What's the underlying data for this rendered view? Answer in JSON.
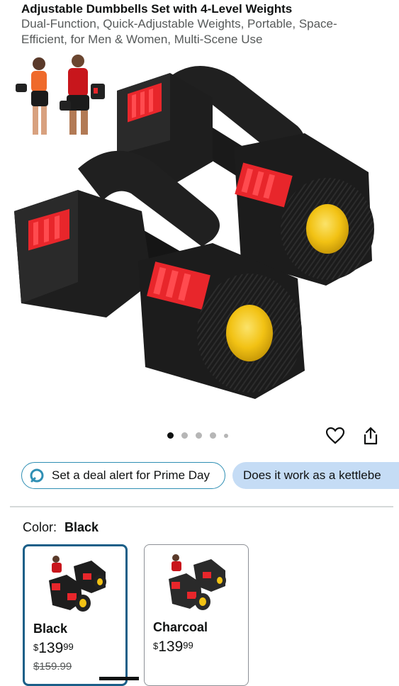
{
  "product": {
    "title": "Adjustable Dumbbells Set with 4-Level Weights",
    "subtitle_line1": "Dual-Function, Quick-Adjustable Weights, Portable, Space-",
    "subtitle_line2": "Efficient, for Men & Women, Multi-Scene Use"
  },
  "gallery": {
    "image_count": 5,
    "active_index": 0,
    "actions": {
      "favorite_icon": "heart-icon",
      "share_icon": "share-icon"
    }
  },
  "chips": {
    "deal_alert": "Set a deal alert for Prime Day",
    "question": "Does it work as a kettlebe"
  },
  "color": {
    "label": "Color:",
    "selected": "Black",
    "options": [
      {
        "name": "Black",
        "price_currency": "$",
        "price_whole": "139",
        "price_fraction": "99",
        "was_price": "$159.99"
      },
      {
        "name": "Charcoal",
        "price_currency": "$",
        "price_whole": "139",
        "price_fraction": "99"
      }
    ]
  },
  "colors": {
    "accent_red": "#e8262b",
    "cap_yellow": "#f2c214",
    "selected_border": "#1b5f88",
    "chip_blue": "#c5dcf5"
  }
}
